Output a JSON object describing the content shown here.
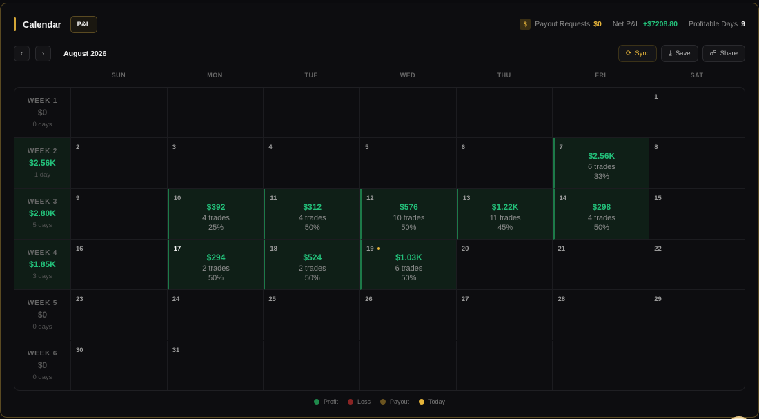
{
  "header": {
    "title": "Calendar",
    "pill": "P&L",
    "payout_icon": "$",
    "payout_label": "Payout Requests",
    "payout_value": "$0",
    "net_label": "Net P&L",
    "net_value": "+$7208.80",
    "profdays_label": "Profitable Days",
    "profdays_value": "9"
  },
  "nav": {
    "month": "August 2026",
    "sync": "Sync",
    "save": "Save",
    "share": "Share"
  },
  "days_of_week": [
    "SUN",
    "MON",
    "TUE",
    "WED",
    "THU",
    "FRI",
    "SAT"
  ],
  "weeks": [
    {
      "label": "WEEK 1",
      "amount": "$0",
      "days": "0 days",
      "profit": false
    },
    {
      "label": "WEEK 2",
      "amount": "$2.56K",
      "days": "1 day",
      "profit": true
    },
    {
      "label": "WEEK 3",
      "amount": "$2.80K",
      "days": "5 days",
      "profit": true
    },
    {
      "label": "WEEK 4",
      "amount": "$1.85K",
      "days": "3 days",
      "profit": true
    },
    {
      "label": "WEEK 5",
      "amount": "$0",
      "days": "0 days",
      "profit": false
    },
    {
      "label": "WEEK 6",
      "amount": "$0",
      "days": "0 days",
      "profit": false
    }
  ],
  "cells": [
    [
      "",
      "",
      "",
      "",
      "",
      "",
      "1"
    ],
    [
      "2",
      "3",
      "4",
      "5",
      "6",
      "7",
      "8"
    ],
    [
      "9",
      "10",
      "11",
      "12",
      "13",
      "14",
      "15"
    ],
    [
      "16",
      "17",
      "18",
      "19",
      "20",
      "21",
      "22"
    ],
    [
      "23",
      "24",
      "25",
      "26",
      "27",
      "28",
      "29"
    ],
    [
      "30",
      "31",
      "",
      "",
      "",
      "",
      ""
    ]
  ],
  "trades": {
    "7": {
      "amount": "$2.56K",
      "trades": "6 trades",
      "winrate": "33%"
    },
    "10": {
      "amount": "$392",
      "trades": "4 trades",
      "winrate": "25%"
    },
    "11": {
      "amount": "$312",
      "trades": "4 trades",
      "winrate": "50%"
    },
    "12": {
      "amount": "$576",
      "trades": "10 trades",
      "winrate": "50%"
    },
    "13": {
      "amount": "$1.22K",
      "trades": "11 trades",
      "winrate": "45%"
    },
    "14": {
      "amount": "$298",
      "trades": "4 trades",
      "winrate": "50%"
    },
    "17": {
      "amount": "$294",
      "trades": "2 trades",
      "winrate": "50%"
    },
    "18": {
      "amount": "$524",
      "trades": "2 trades",
      "winrate": "50%"
    },
    "19": {
      "amount": "$1.03K",
      "trades": "6 trades",
      "winrate": "50%"
    }
  },
  "today": "17",
  "payout_marker_day": "19",
  "legend": [
    {
      "label": "Profit",
      "color": "#1f8a4c"
    },
    {
      "label": "Loss",
      "color": "#8a2424"
    },
    {
      "label": "Payout",
      "color": "#6b5420"
    },
    {
      "label": "Today",
      "color": "#e6b43a"
    }
  ],
  "colors": {
    "accent": "#d4a637",
    "profit": "#23c07a"
  }
}
